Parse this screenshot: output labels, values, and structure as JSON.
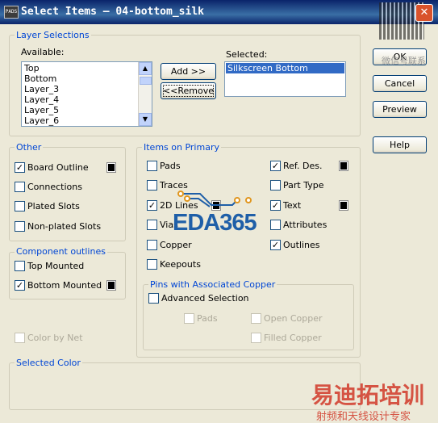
{
  "window": {
    "title": "Select Items – 04-bottom_silk",
    "app_icon": "PADS",
    "close": "✕"
  },
  "watermark_qr_caption": "微信号联系",
  "layer_selections": {
    "legend": "Layer Selections",
    "available_label": "Available:",
    "available_items": [
      "Top",
      "Bottom",
      "Layer_3",
      "Layer_4",
      "Layer_5",
      "Layer_6"
    ],
    "selected_label": "Selected:",
    "selected_items": [
      "Silkscreen Bottom"
    ],
    "add_button": "Add >>",
    "remove_button": "<<Remove"
  },
  "buttons": {
    "ok": "OK",
    "cancel": "Cancel",
    "preview": "Preview",
    "help": "Help"
  },
  "other": {
    "legend": "Other",
    "items": [
      {
        "label": "Board Outline",
        "checked": true,
        "color": "#000000"
      },
      {
        "label": "Connections",
        "checked": false
      },
      {
        "label": "Plated Slots",
        "checked": false
      },
      {
        "label": "Non-plated Slots",
        "checked": false
      }
    ]
  },
  "component_outlines": {
    "legend": "Component outlines",
    "items": [
      {
        "label": "Top Mounted",
        "checked": false
      },
      {
        "label": "Bottom Mounted",
        "checked": true,
        "color": "#000000"
      }
    ]
  },
  "color_by_net": {
    "label": "Color by Net",
    "checked": false,
    "enabled": false
  },
  "items_on_primary": {
    "legend": "Items on Primary",
    "left": [
      {
        "label": "Pads",
        "checked": false
      },
      {
        "label": "Traces",
        "checked": false
      },
      {
        "label": "2D Lines",
        "checked": true,
        "color": "#000000"
      },
      {
        "label": "Vias",
        "checked": false
      },
      {
        "label": "Copper",
        "checked": false
      },
      {
        "label": "Keepouts",
        "checked": false
      }
    ],
    "right": [
      {
        "label": "Ref. Des.",
        "checked": true,
        "color": "#000000"
      },
      {
        "label": "Part Type",
        "checked": false
      },
      {
        "label": "Text",
        "checked": true,
        "color": "#000000"
      },
      {
        "label": "Attributes",
        "checked": false
      },
      {
        "label": "Outlines",
        "checked": true
      }
    ]
  },
  "pins_group": {
    "legend": "Pins with Associated Copper",
    "advanced": {
      "label": "Advanced Selection",
      "checked": false
    },
    "options": [
      {
        "label": "Pads",
        "checked": false,
        "enabled": false
      },
      {
        "label": "Open Copper",
        "checked": false,
        "enabled": false
      },
      {
        "label": "Filled Copper",
        "checked": false,
        "enabled": false
      }
    ]
  },
  "selected_color": {
    "legend": "Selected Color"
  },
  "watermarks": {
    "eda": "EDA365",
    "training": "易迪拓培训",
    "training_sub": "射频和天线设计专家"
  },
  "colors": {
    "legend_text": "#0046d5",
    "title_gradient": "#0a246a",
    "selection": "#316ac5",
    "eda_blue": "#1f5fa8",
    "watermark_red": "#d23a2a"
  }
}
